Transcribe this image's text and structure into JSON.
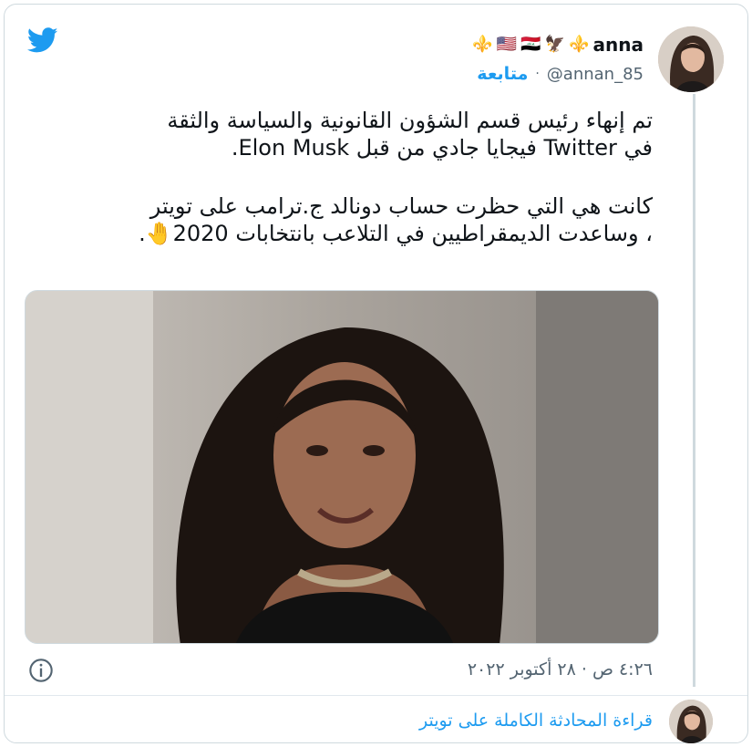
{
  "icons": {
    "brand": "twitter-bird-icon",
    "info": "info-icon"
  },
  "colors": {
    "accent": "#1d9bf0",
    "text": "#0f1419",
    "muted": "#536471",
    "border": "#cfd9de"
  },
  "author": {
    "name": "anna",
    "emojis": [
      "⚜️",
      "🦅",
      "🇮🇶",
      "🇺🇸",
      "⚜️"
    ],
    "handle": "@annan_85",
    "separator": "·",
    "follow_label": "متابعة"
  },
  "tweet": {
    "paragraph1_line1": "تم إنهاء رئيس قسم الشؤون القانونية والسياسة والثقة",
    "paragraph1_line2": "في Twitter فيجايا جادي من قبل Elon Musk.",
    "paragraph2_line1": "كانت هي التي حظرت حساب دونالد ج.ترامب على تويتر",
    "paragraph2_line2": "، وساعدت الديمقراطيين في التلاعب بانتخابات 2020🤚."
  },
  "timestamp": "٤:٢٦ ص · ٢٨ أكتوبر ٢٠٢٢",
  "read_conversation": "قراءة المحادثة الكاملة على تويتر"
}
